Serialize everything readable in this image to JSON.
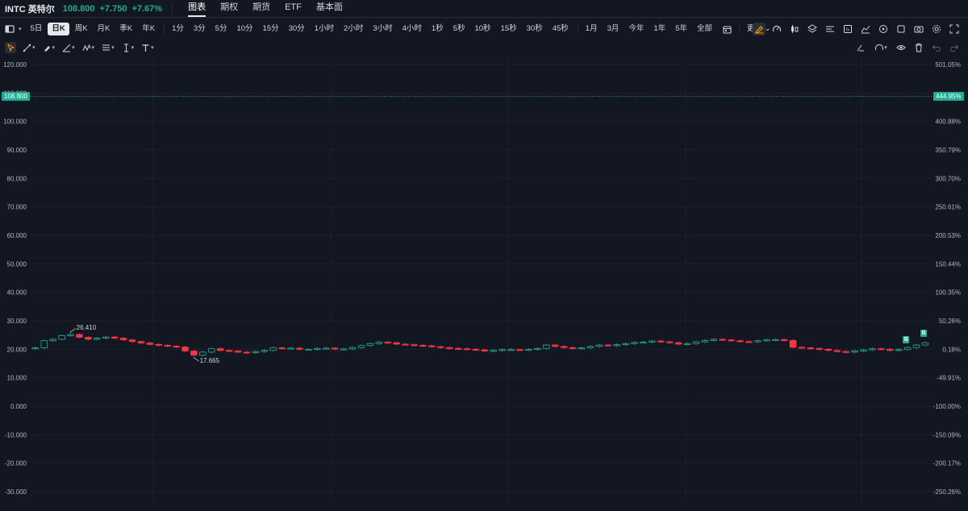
{
  "header": {
    "ticker": "INTC 英特尔",
    "price": "108.800",
    "change": "+7.750",
    "change_pct": "+7.67%",
    "tabs": [
      {
        "label": "图表",
        "active": true
      },
      {
        "label": "期权",
        "active": false
      },
      {
        "label": "期货",
        "active": false
      },
      {
        "label": "ETF",
        "active": false
      },
      {
        "label": "基本面",
        "active": false
      }
    ]
  },
  "timeframes": {
    "group1": [
      "5日",
      "日K",
      "周K",
      "月K",
      "季K",
      "年K"
    ],
    "group2": [
      "1分",
      "3分",
      "5分",
      "10分",
      "15分",
      "30分",
      "1小时",
      "2小时",
      "3小时",
      "4小时",
      "1秒",
      "5秒",
      "10秒",
      "15秒",
      "30秒",
      "45秒"
    ],
    "group3": [
      "1月",
      "3月",
      "今年",
      "1年",
      "5年",
      "全部"
    ],
    "active": "日K",
    "more_label": "更多"
  },
  "right_toolbar_icons": [
    "draw-pen-icon",
    "gauge-icon",
    "candle-type-icon",
    "layers-icon",
    "align-left-icon",
    "indicator-icon",
    "chart-area-icon",
    "replay-icon",
    "square-icon",
    "camera-icon",
    "settings-icon",
    "fullscreen-icon"
  ],
  "drawing_tools": [
    "cursor-icon",
    "trend-line-icon",
    "brush-icon",
    "measure-icon",
    "pattern-icon",
    "fib-icon",
    "text-cursor-icon",
    "text-icon"
  ],
  "drawing_right_icons": [
    "magnet-icon",
    "gauge-draw-icon",
    "eye-icon",
    "trash-icon",
    "undo-icon",
    "redo-icon"
  ],
  "chart": {
    "current_price_tag": "108.800",
    "current_pct_tag": "444.95%",
    "high_label": "26.410",
    "low_label": "17.665",
    "signal_mark": "B",
    "colors": {
      "up": "#22ab94",
      "down": "#f23645",
      "background": "#131722",
      "grid": "#1e222d"
    }
  },
  "chart_data": {
    "type": "candlestick",
    "title": "",
    "y_ticks_left": [
      "120.000",
      "110.000",
      "100.000",
      "90.000",
      "80.000",
      "70.000",
      "60.000",
      "50.000",
      "40.000",
      "30.000",
      "20.000",
      "10.000",
      "0.000",
      "-10.000",
      "-20.000",
      "-30.000"
    ],
    "y_ticks_right": [
      "501.05%",
      "",
      "400.88%",
      "350.79%",
      "300.70%",
      "250.61%",
      "200.53%",
      "150.44%",
      "100.35%",
      "50.26%",
      "0.18%",
      "-49.91%",
      "-100.00%",
      "-150.09%",
      "-200.17%",
      "-250.26%"
    ],
    "ylim": [
      -30,
      120
    ],
    "current_price": 108.8,
    "closes": [
      20.5,
      23.0,
      23.5,
      24.8,
      25.2,
      24.2,
      23.5,
      23.9,
      24.3,
      23.9,
      23.3,
      22.7,
      22.2,
      21.7,
      21.4,
      21.1,
      20.8,
      19.4,
      17.9,
      19.0,
      20.2,
      19.6,
      19.4,
      19.0,
      18.8,
      19.2,
      19.6,
      20.5,
      20.3,
      20.4,
      20.0,
      20.0,
      20.3,
      20.4,
      20.1,
      20.1,
      20.6,
      21.3,
      22.0,
      22.5,
      22.3,
      21.8,
      21.6,
      21.4,
      21.2,
      20.9,
      20.6,
      20.3,
      20.2,
      20.0,
      19.8,
      19.4,
      19.6,
      19.9,
      19.9,
      19.8,
      20.0,
      20.3,
      21.5,
      21.0,
      20.6,
      20.3,
      20.5,
      21.0,
      21.5,
      21.3,
      21.6,
      22.0,
      22.4,
      22.5,
      22.9,
      22.6,
      22.3,
      21.8,
      22.0,
      22.6,
      23.1,
      23.5,
      23.3,
      23.0,
      22.7,
      22.6,
      23.0,
      23.3,
      23.4,
      23.1,
      20.7,
      20.5,
      20.3,
      20.0,
      19.6,
      19.2,
      19.0,
      19.4,
      19.8,
      20.2,
      20.0,
      19.6,
      19.9,
      20.6,
      21.5,
      22.3
    ]
  }
}
